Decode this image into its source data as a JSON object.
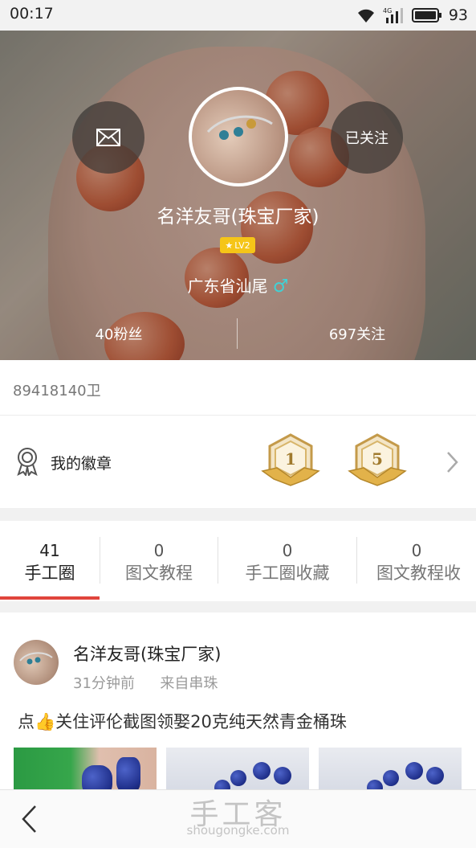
{
  "status_bar": {
    "time": "00:17",
    "network": "4G",
    "battery": "93"
  },
  "profile": {
    "name": "名洋友哥(珠宝厂家)",
    "level": "LV2",
    "location": "广东省汕尾",
    "gender_symbol": "♂",
    "fans": "40粉丝",
    "following": "697关注",
    "follow_button": "已关注",
    "user_id": "89418140卫"
  },
  "badges": {
    "label": "我的徽章",
    "medal_1": "1",
    "medal_2": "5"
  },
  "tabs": [
    {
      "count": "41",
      "label": "手工圈"
    },
    {
      "count": "0",
      "label": "图文教程"
    },
    {
      "count": "0",
      "label": "手工圈收藏"
    },
    {
      "count": "0",
      "label": "图文教程收"
    }
  ],
  "post": {
    "author": "名洋友哥(珠宝厂家)",
    "time": "31分钟前",
    "source": "来自串珠",
    "text_prefix": "点",
    "emoji": "👍",
    "text_suffix": "关住评伦截图领娶20克纯天然青金桶珠"
  },
  "bottom_nav": {
    "logo": "手工客",
    "url": "shougongke.com"
  },
  "colors": {
    "accent": "#e0453c",
    "gender": "#3fd2d6",
    "level": "#f5c518"
  }
}
